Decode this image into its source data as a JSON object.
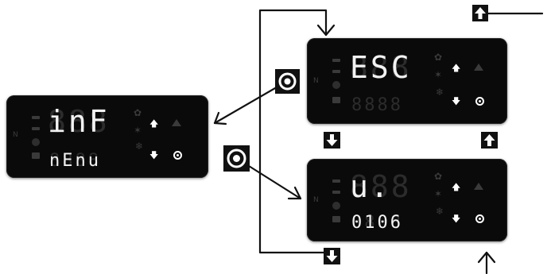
{
  "panels": {
    "inf": {
      "main_text": "inF",
      "sub_text": "nEnu"
    },
    "esc": {
      "main_text": "ESC",
      "sub_text": ""
    },
    "ver": {
      "main_text": "u.",
      "sub_text": "0106"
    }
  },
  "icons": {
    "prg_button": "prg-circle-icon",
    "up_key": "up-arrow-icon",
    "down_key": "down-arrow-icon"
  },
  "colors": {
    "panel_bg": "#0a0a0a",
    "lit_segment": "#f2f2f2",
    "unlit_segment": "#2c2c2c",
    "connector": "#111111"
  }
}
